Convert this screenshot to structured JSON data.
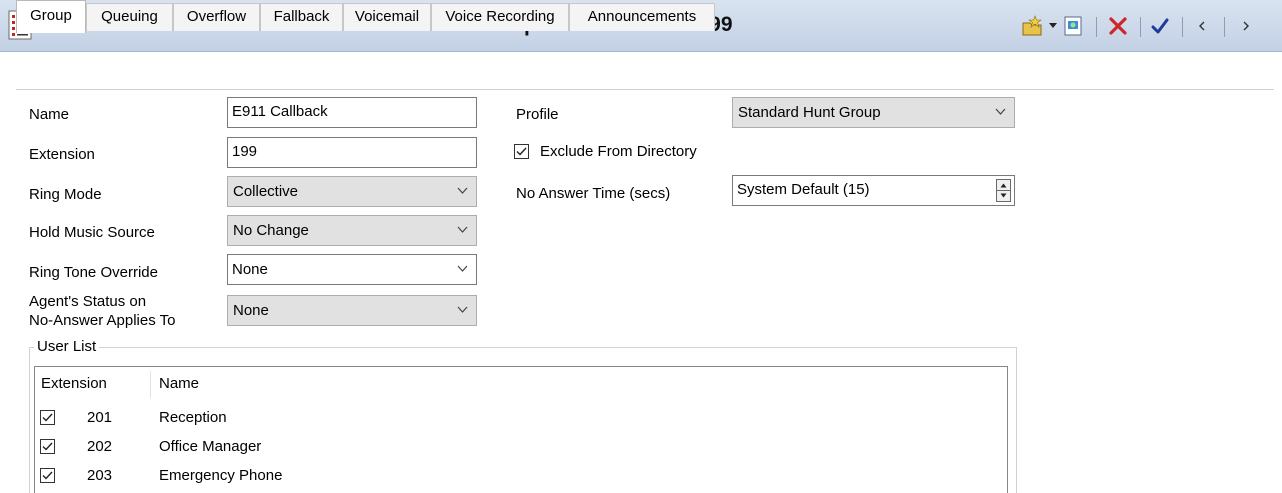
{
  "window": {
    "title": "Collective Group E911 Callback: 199"
  },
  "tabs": [
    {
      "label": "Group",
      "active": true
    },
    {
      "label": "Queuing"
    },
    {
      "label": "Overflow"
    },
    {
      "label": "Fallback"
    },
    {
      "label": "Voicemail"
    },
    {
      "label": "Voice Recording"
    },
    {
      "label": "Announcements"
    }
  ],
  "form": {
    "name_label": "Name",
    "name_value": "E911 Callback",
    "extension_label": "Extension",
    "extension_value": "199",
    "ring_mode_label": "Ring Mode",
    "ring_mode_value": "Collective",
    "hold_music_label": "Hold Music Source",
    "hold_music_value": "No Change",
    "ring_tone_label": "Ring Tone Override",
    "ring_tone_value": "None",
    "agent_status_label_line1": "Agent's Status on",
    "agent_status_label_line2": "No-Answer Applies To",
    "agent_status_value": "None",
    "profile_label": "Profile",
    "profile_value": "Standard Hunt Group",
    "exclude_label": "Exclude From Directory",
    "exclude_checked": true,
    "no_answer_label": "No Answer Time (secs)",
    "no_answer_value": "System Default (15)"
  },
  "user_list": {
    "title": "User List",
    "columns": [
      "Extension",
      "Name"
    ],
    "rows": [
      {
        "extension": "201",
        "name": "Reception",
        "checked": true
      },
      {
        "extension": "202",
        "name": "Office Manager",
        "checked": true
      },
      {
        "extension": "203",
        "name": "Emergency Phone",
        "checked": true
      }
    ]
  },
  "icons": [
    "list-menu-icon",
    "new-item-icon",
    "dropdown-arrow-icon",
    "export-icon",
    "delete-icon",
    "ok-check-icon",
    "previous-icon",
    "next-icon"
  ],
  "colors": {
    "title_bar": "#c3d1e5",
    "delete_red": "#d0262a",
    "ok_blue": "#1c3c9c"
  }
}
